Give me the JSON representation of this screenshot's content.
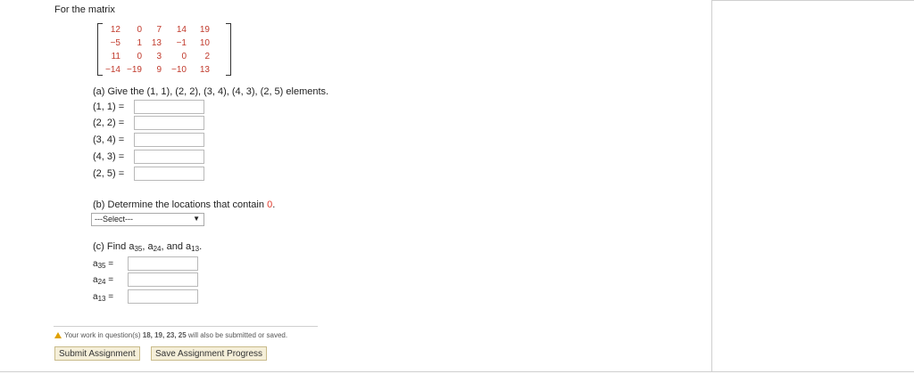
{
  "intro": "For the matrix",
  "matrix": [
    [
      "12",
      "0",
      "7",
      "14",
      "19"
    ],
    [
      "−5",
      "1",
      "13",
      "−1",
      "10"
    ],
    [
      "11",
      "0",
      "3",
      "0",
      "2"
    ],
    [
      "−14",
      "−19",
      "9",
      "−10",
      "13"
    ]
  ],
  "part_a": {
    "prompt": "(a) Give the (1, 1), (2, 2), (3, 4), (4, 3), (2, 5) elements.",
    "rows": [
      {
        "label": "(1, 1) =",
        "value": ""
      },
      {
        "label": "(2, 2) =",
        "value": ""
      },
      {
        "label": "(3, 4) =",
        "value": ""
      },
      {
        "label": "(4, 3) =",
        "value": ""
      },
      {
        "label": "(2, 5) =",
        "value": ""
      }
    ]
  },
  "part_b": {
    "prompt": "(b) Determine the locations that contain",
    "target": "0",
    "period": ".",
    "select_value": "---Select---"
  },
  "part_c": {
    "prompt_start": "(c) Find a",
    "sub1": "35",
    "sep1": ", a",
    "sub2": "24",
    "sep2": ", and a",
    "sub3": "13",
    "period": ".",
    "rows": [
      {
        "var": "a",
        "sub": "35",
        "eq": "=",
        "value": ""
      },
      {
        "var": "a",
        "sub": "24",
        "eq": "=",
        "value": ""
      },
      {
        "var": "a",
        "sub": "13",
        "eq": "=",
        "value": ""
      }
    ]
  },
  "notice": {
    "text_start": "Your work in question(s) ",
    "questions": "18, 19, 23, 25",
    "text_end": " will also be submitted or saved.",
    "icon": "warning-icon"
  },
  "buttons": {
    "submit": "Submit Assignment",
    "save": "Save Assignment Progress"
  }
}
